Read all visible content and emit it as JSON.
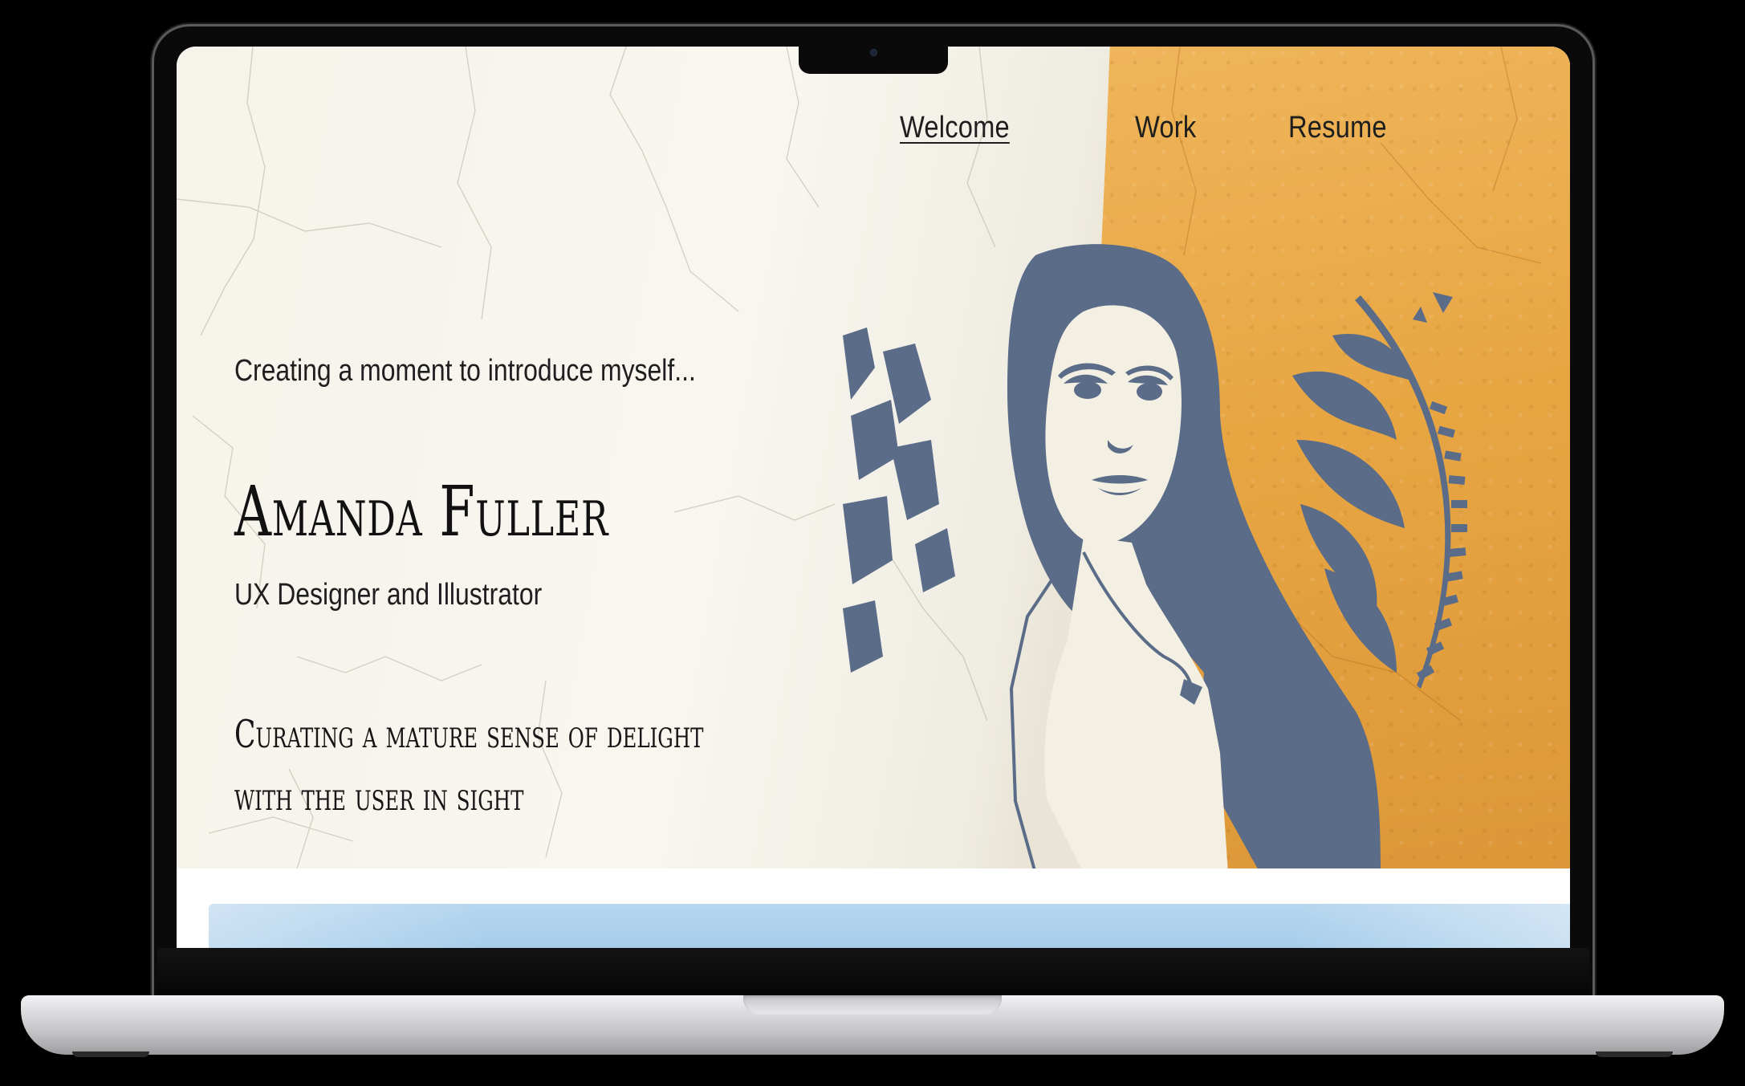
{
  "nav": {
    "items": [
      {
        "label": "Welcome",
        "active": true
      },
      {
        "label": "Work",
        "active": false
      },
      {
        "label": "Resume",
        "active": false
      }
    ]
  },
  "hero": {
    "intro": "Creating a moment to introduce myself...",
    "name": "Amanda Fuller",
    "role": "UX Designer and Illustrator",
    "tagline_line1": "Curating a mature sense of delight",
    "tagline_line2": "with the user in sight"
  },
  "colors": {
    "background_wall": "#f6f4ec",
    "accent_orange": "#e8a643",
    "portrait_blue": "#5a6c88",
    "section_blue": "#a8cdea"
  },
  "images": {
    "portrait": "stencil-portrait-illustration"
  }
}
